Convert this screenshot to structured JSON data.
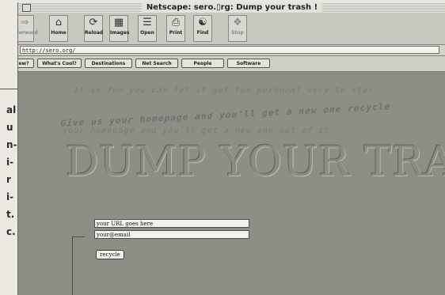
{
  "window": {
    "title": "Netscape: sero.▯rg: Dump your trash !"
  },
  "toolbar": {
    "buttons": [
      {
        "label": "Forward",
        "icon": "forward-arrow-icon"
      },
      {
        "label": "Home",
        "icon": "home-icon"
      },
      {
        "label": "Reload",
        "icon": "reload-icon"
      },
      {
        "label": "Images",
        "icon": "images-icon"
      },
      {
        "label": "Open",
        "icon": "open-icon"
      },
      {
        "label": "Print",
        "icon": "print-icon"
      },
      {
        "label": "Find",
        "icon": "find-binoculars-icon"
      },
      {
        "label": "Stop",
        "icon": "stop-icon"
      }
    ]
  },
  "location": {
    "url": "http://sero.org/"
  },
  "directory": {
    "buttons": [
      "ew?",
      "What's Cool?",
      "Destinations",
      "Net Search",
      "People",
      "Software"
    ]
  },
  "page": {
    "ghost_line_1": "It is fun you can let it get too personal very to star",
    "ghost_line_2": "Give us your homepage and you'll get a new one recycle",
    "ghost_line_3": "your homepage and you'll get a new one out of it",
    "headline": "DUMP YOUR TRASH !",
    "form": {
      "url_field": "your URL goes here",
      "email_field": "your@email",
      "submit_label": "recycle"
    }
  },
  "magazine_text": [
    "al",
    "u",
    "n-",
    "i-",
    "r",
    "i-",
    "t.",
    "c."
  ]
}
